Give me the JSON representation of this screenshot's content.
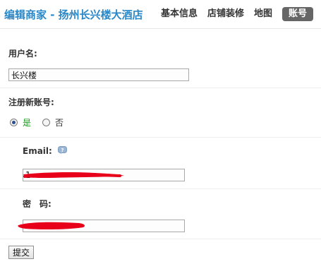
{
  "header": {
    "title": "编辑商家 - 扬州长兴楼大酒店",
    "nav": [
      "基本信息",
      "店铺装修",
      "地图",
      "账号"
    ],
    "active_tab": "账号"
  },
  "form": {
    "username_label": "用户名:",
    "username_value": "长兴楼",
    "register_label": "注册新账号:",
    "radio_yes": "是",
    "radio_no": "否",
    "email_label": "Email:",
    "email_value": "1",
    "password_label": "密　码:",
    "submit_label": "提交"
  },
  "colors": {
    "title": "#2a88c8",
    "active_tab_bg": "#666666",
    "yes_label": "#1a9a1a",
    "redaction": "#e8001a"
  },
  "icons": {
    "help": "help-question-icon"
  }
}
